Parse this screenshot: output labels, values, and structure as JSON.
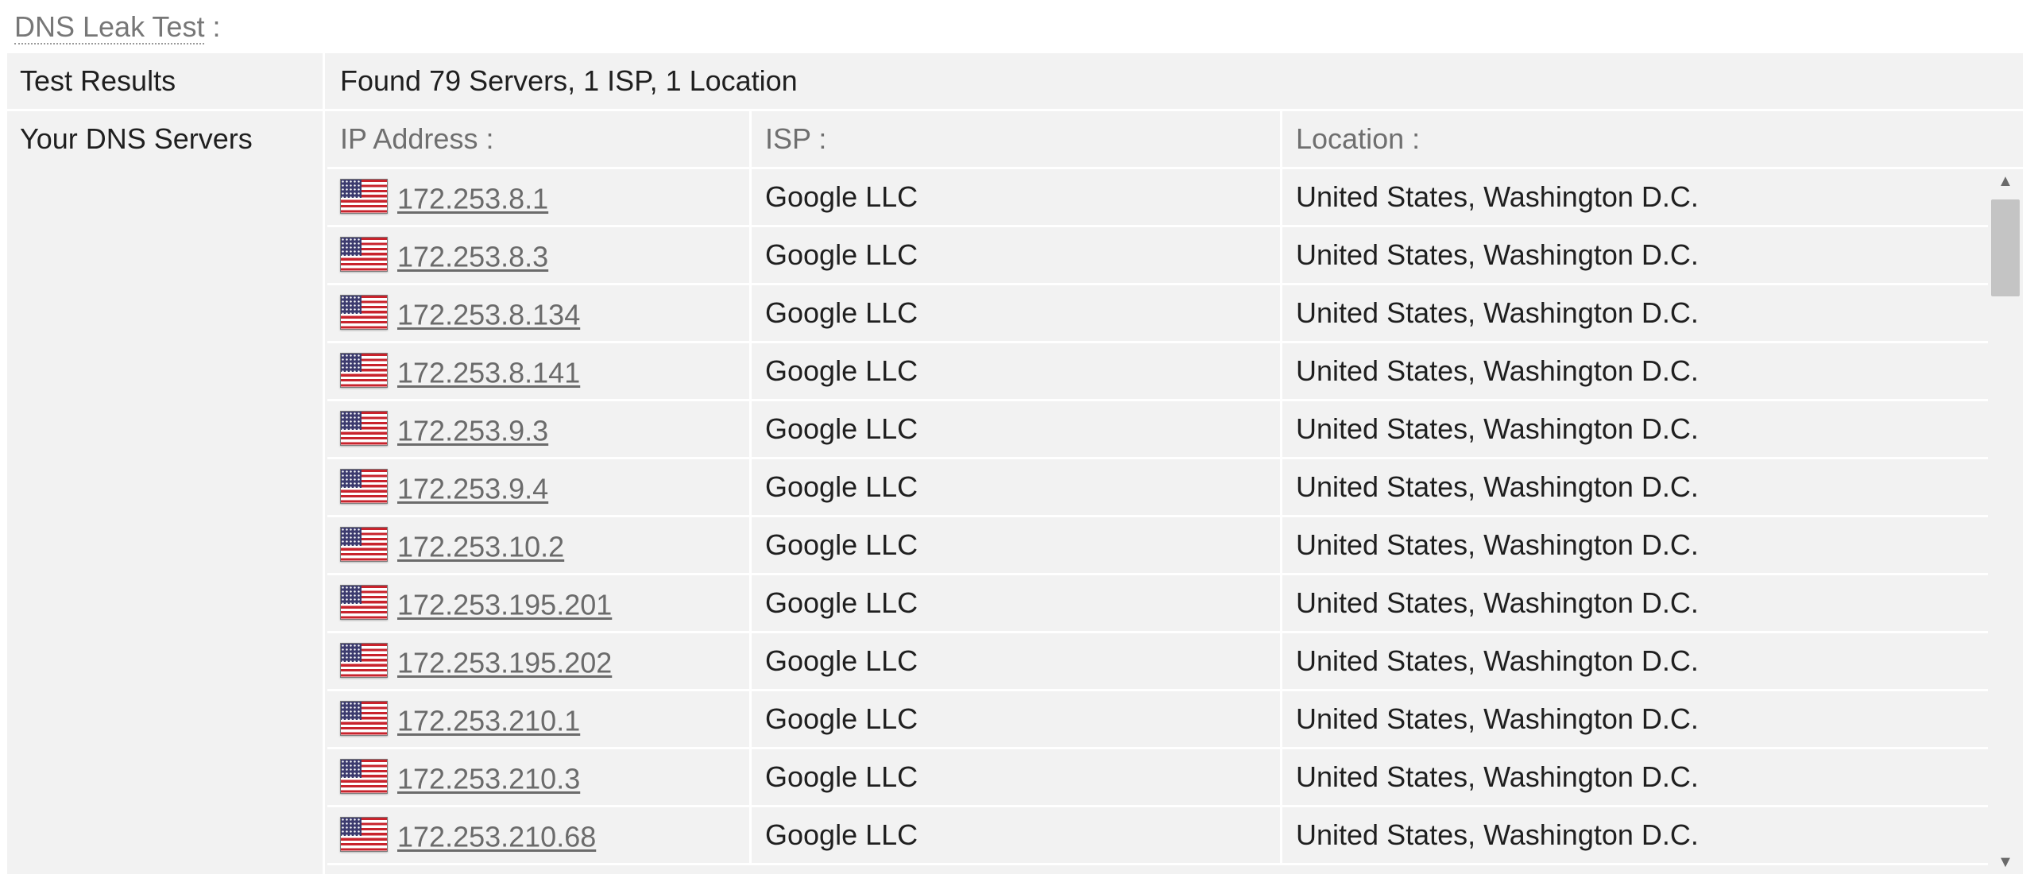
{
  "page_title": "DNS Leak Test",
  "page_title_suffix": ":",
  "results_row": {
    "label": "Test Results",
    "value": "Found 79 Servers, 1 ISP, 1 Location"
  },
  "servers_row": {
    "label": "Your DNS Servers",
    "headers": {
      "ip": "IP Address :",
      "isp": "ISP :",
      "location": "Location :"
    },
    "rows": [
      {
        "flag": "us-flag-icon",
        "ip": "172.253.8.1",
        "isp": "Google LLC",
        "location": "United States, Washington D.C."
      },
      {
        "flag": "us-flag-icon",
        "ip": "172.253.8.3",
        "isp": "Google LLC",
        "location": "United States, Washington D.C."
      },
      {
        "flag": "us-flag-icon",
        "ip": "172.253.8.134",
        "isp": "Google LLC",
        "location": "United States, Washington D.C."
      },
      {
        "flag": "us-flag-icon",
        "ip": "172.253.8.141",
        "isp": "Google LLC",
        "location": "United States, Washington D.C."
      },
      {
        "flag": "us-flag-icon",
        "ip": "172.253.9.3",
        "isp": "Google LLC",
        "location": "United States, Washington D.C."
      },
      {
        "flag": "us-flag-icon",
        "ip": "172.253.9.4",
        "isp": "Google LLC",
        "location": "United States, Washington D.C."
      },
      {
        "flag": "us-flag-icon",
        "ip": "172.253.10.2",
        "isp": "Google LLC",
        "location": "United States, Washington D.C."
      },
      {
        "flag": "us-flag-icon",
        "ip": "172.253.195.201",
        "isp": "Google LLC",
        "location": "United States, Washington D.C."
      },
      {
        "flag": "us-flag-icon",
        "ip": "172.253.195.202",
        "isp": "Google LLC",
        "location": "United States, Washington D.C."
      },
      {
        "flag": "us-flag-icon",
        "ip": "172.253.210.1",
        "isp": "Google LLC",
        "location": "United States, Washington D.C."
      },
      {
        "flag": "us-flag-icon",
        "ip": "172.253.210.3",
        "isp": "Google LLC",
        "location": "United States, Washington D.C."
      },
      {
        "flag": "us-flag-icon",
        "ip": "172.253.210.68",
        "isp": "Google LLC",
        "location": "United States, Washington D.C."
      }
    ]
  },
  "scrollbar": {
    "up_icon": "scroll-up-arrow-icon",
    "down_icon": "scroll-down-arrow-icon"
  }
}
